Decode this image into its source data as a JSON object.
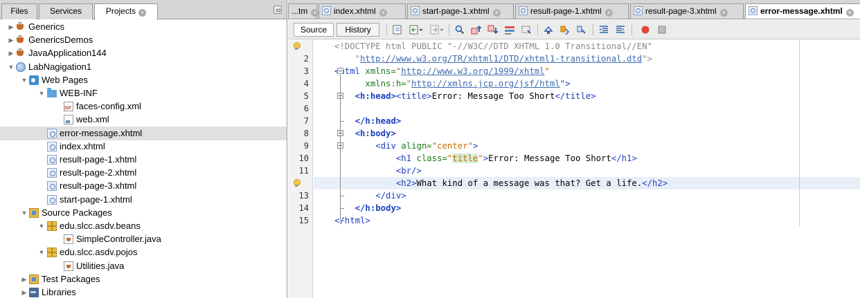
{
  "left_panel": {
    "tabs": [
      {
        "label": "Files"
      },
      {
        "label": "Services"
      },
      {
        "label": "Projects",
        "closable": true,
        "active": true
      }
    ],
    "tree": [
      {
        "label": "Generics",
        "icon": "java-project-icon",
        "toggle": "▶",
        "level": 0
      },
      {
        "label": "GenericsDemos",
        "icon": "java-project-icon",
        "toggle": "▶",
        "level": 0
      },
      {
        "label": "JavaApplication144",
        "icon": "java-project-icon",
        "toggle": "▶",
        "level": 0
      },
      {
        "label": "LabNagigation1",
        "icon": "web-project-icon",
        "toggle": "▼",
        "level": 0
      },
      {
        "label": "Web Pages",
        "icon": "web-pages-icon",
        "toggle": "▼",
        "level": 1
      },
      {
        "label": "WEB-INF",
        "icon": "folder-icon",
        "toggle": "▼",
        "level": 2
      },
      {
        "label": "faces-config.xml",
        "icon": "jsf-config-icon",
        "toggle": "",
        "level": 3
      },
      {
        "label": "web.xml",
        "icon": "xml-file-icon",
        "toggle": "",
        "level": 3
      },
      {
        "label": "error-message.xhtml",
        "icon": "xhtml-file-icon",
        "toggle": "",
        "level": 2,
        "selected": true
      },
      {
        "label": "index.xhtml",
        "icon": "xhtml-file-icon",
        "toggle": "",
        "level": 2
      },
      {
        "label": "result-page-1.xhtml",
        "icon": "xhtml-file-icon",
        "toggle": "",
        "level": 2
      },
      {
        "label": "result-page-2.xhtml",
        "icon": "xhtml-file-icon",
        "toggle": "",
        "level": 2
      },
      {
        "label": "result-page-3.xhtml",
        "icon": "xhtml-file-icon",
        "toggle": "",
        "level": 2
      },
      {
        "label": "start-page-1.xhtml",
        "icon": "xhtml-file-icon",
        "toggle": "",
        "level": 2
      },
      {
        "label": "Source Packages",
        "icon": "source-packages-icon",
        "toggle": "▼",
        "level": 1
      },
      {
        "label": "edu.slcc.asdv.beans",
        "icon": "package-icon",
        "toggle": "▼",
        "level": 2
      },
      {
        "label": "SimpleController.java",
        "icon": "java-file-icon",
        "toggle": "",
        "level": 3
      },
      {
        "label": "edu.slcc.asdv.pojos",
        "icon": "package-icon",
        "toggle": "▼",
        "level": 2
      },
      {
        "label": "Utilities.java",
        "icon": "java-file-icon",
        "toggle": "",
        "level": 3
      },
      {
        "label": "Test Packages",
        "icon": "source-packages-icon",
        "toggle": "▶",
        "level": 1
      },
      {
        "label": "Libraries",
        "icon": "libraries-icon",
        "toggle": "▶",
        "level": 1
      }
    ]
  },
  "editor_tabs": [
    {
      "label": "...tm",
      "icon": false
    },
    {
      "label": "index.xhtml",
      "icon": true
    },
    {
      "label": "start-page-1.xhtml",
      "icon": true
    },
    {
      "label": "result-page-1.xhtml",
      "icon": true
    },
    {
      "label": "result-page-3.xhtml",
      "icon": true
    },
    {
      "label": "error-message.xhtml",
      "icon": true,
      "active": true
    }
  ],
  "toolbar": {
    "source_label": "Source",
    "history_label": "History"
  },
  "gutter": {
    "line_numbers": [
      "",
      "2",
      "3",
      "4",
      "5",
      "6",
      "7",
      "8",
      "9",
      "10",
      "11",
      "",
      "13",
      "14",
      "15"
    ]
  },
  "code_lines": [
    [
      {
        "t": "<!DOCTYPE html PUBLIC \"-//W3C//DTD XHTML 1.0 Transitional//EN\"",
        "c": "doc"
      }
    ],
    [
      {
        "t": "    \"",
        "c": "doc"
      },
      {
        "t": "http://www.w3.org/TR/xhtml1/DTD/xhtml1-transitional.dtd",
        "c": "url"
      },
      {
        "t": "\">",
        "c": "doc"
      }
    ],
    [
      {
        "t": "<html ",
        "c": "tag"
      },
      {
        "t": "xmlns=",
        "c": "attr"
      },
      {
        "t": "\"",
        "c": "str"
      },
      {
        "t": "http://www.w3.org/1999/xhtml",
        "c": "url"
      },
      {
        "t": "\"",
        "c": "str"
      }
    ],
    [
      {
        "t": "      ",
        "c": "txt"
      },
      {
        "t": "xmlns:h=",
        "c": "attr"
      },
      {
        "t": "\"",
        "c": "str"
      },
      {
        "t": "http://xmlns.jcp.org/jsf/html",
        "c": "url"
      },
      {
        "t": "\">",
        "c": "tag"
      }
    ],
    [
      {
        "t": "    ",
        "c": "txt"
      },
      {
        "t": "<h:head>",
        "c": "jsf"
      },
      {
        "t": "<title>",
        "c": "tag"
      },
      {
        "t": "Error: Message Too Short",
        "c": "txt"
      },
      {
        "t": "</title>",
        "c": "tag"
      }
    ],
    [],
    [
      {
        "t": "    ",
        "c": "txt"
      },
      {
        "t": "</h:head>",
        "c": "jsf"
      }
    ],
    [
      {
        "t": "    ",
        "c": "txt"
      },
      {
        "t": "<h:body>",
        "c": "jsf"
      }
    ],
    [
      {
        "t": "        ",
        "c": "txt"
      },
      {
        "t": "<div ",
        "c": "tag"
      },
      {
        "t": "align=",
        "c": "attr"
      },
      {
        "t": "\"center\"",
        "c": "str"
      },
      {
        "t": ">",
        "c": "tag"
      }
    ],
    [
      {
        "t": "            ",
        "c": "txt"
      },
      {
        "t": "<h1 ",
        "c": "tag"
      },
      {
        "t": "class=",
        "c": "attr"
      },
      {
        "t": "\"",
        "c": "str"
      },
      {
        "t": "title",
        "c": "strhl"
      },
      {
        "t": "\"",
        "c": "str"
      },
      {
        "t": ">",
        "c": "tag"
      },
      {
        "t": "Error: Message Too Short",
        "c": "txt"
      },
      {
        "t": "</h1>",
        "c": "tag"
      }
    ],
    [
      {
        "t": "            ",
        "c": "txt"
      },
      {
        "t": "<br/>",
        "c": "tag"
      }
    ],
    [
      {
        "t": "            ",
        "c": "txt"
      },
      {
        "t": "<h2>",
        "c": "tag"
      },
      {
        "t": "What kind of a message was that? Get a life.",
        "c": "txt"
      },
      {
        "t": "</h2>",
        "c": "tag"
      }
    ],
    [
      {
        "t": "        ",
        "c": "txt"
      },
      {
        "t": "</div>",
        "c": "tag"
      }
    ],
    [
      {
        "t": "    ",
        "c": "txt"
      },
      {
        "t": "</h:body>",
        "c": "jsf"
      }
    ],
    [
      {
        "t": "</html>",
        "c": "tag"
      }
    ]
  ],
  "current_line_index": 11
}
